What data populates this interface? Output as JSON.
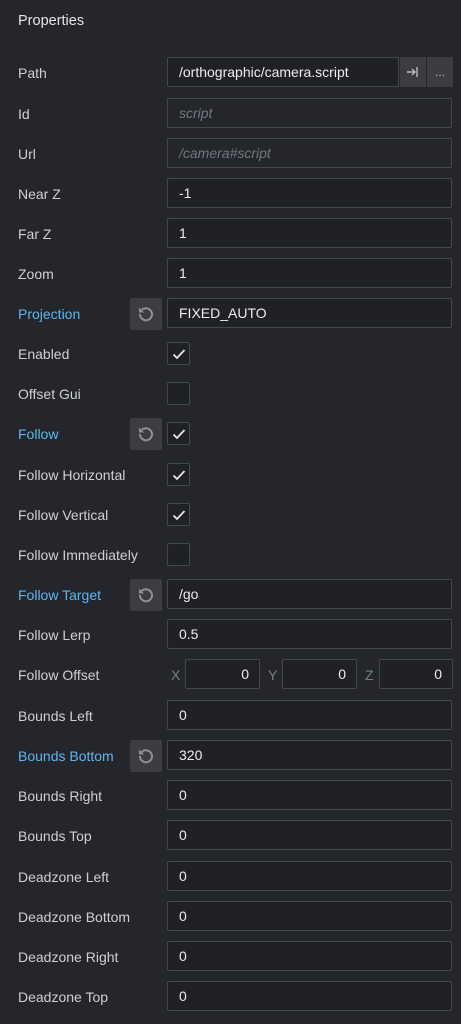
{
  "panel_title": "Properties",
  "path": {
    "label": "Path",
    "value": "/orthographic/camera.script",
    "goto_icon": "goto-file-icon",
    "browse_label": "..."
  },
  "id": {
    "label": "Id",
    "placeholder": "script"
  },
  "url": {
    "label": "Url",
    "placeholder": "/camera#script"
  },
  "near_z": {
    "label": "Near Z",
    "value": "-1"
  },
  "far_z": {
    "label": "Far Z",
    "value": "1"
  },
  "zoom": {
    "label": "Zoom",
    "value": "1"
  },
  "projection": {
    "label": "Projection",
    "value": "FIXED_AUTO"
  },
  "enabled": {
    "label": "Enabled",
    "checked": true
  },
  "offset_gui": {
    "label": "Offset Gui",
    "checked": false
  },
  "follow": {
    "label": "Follow",
    "checked": true
  },
  "follow_horizontal": {
    "label": "Follow Horizontal",
    "checked": true
  },
  "follow_vertical": {
    "label": "Follow Vertical",
    "checked": true
  },
  "follow_immediately": {
    "label": "Follow Immediately",
    "checked": false
  },
  "follow_target": {
    "label": "Follow Target",
    "value": "/go"
  },
  "follow_lerp": {
    "label": "Follow Lerp",
    "value": "0.5"
  },
  "follow_offset": {
    "label": "Follow Offset",
    "x_label": "X",
    "x": "0",
    "y_label": "Y",
    "y": "0",
    "z_label": "Z",
    "z": "0"
  },
  "bounds_left": {
    "label": "Bounds Left",
    "value": "0"
  },
  "bounds_bottom": {
    "label": "Bounds Bottom",
    "value": "320"
  },
  "bounds_right": {
    "label": "Bounds Right",
    "value": "0"
  },
  "bounds_top": {
    "label": "Bounds Top",
    "value": "0"
  },
  "deadzone_left": {
    "label": "Deadzone Left",
    "value": "0"
  },
  "deadzone_bottom": {
    "label": "Deadzone Bottom",
    "value": "0"
  },
  "deadzone_right": {
    "label": "Deadzone Right",
    "value": "0"
  },
  "deadzone_top": {
    "label": "Deadzone Top",
    "value": "0"
  },
  "colors": {
    "changed_label": "#5db6ef",
    "background": "#24262b",
    "field": "#1f2124"
  }
}
